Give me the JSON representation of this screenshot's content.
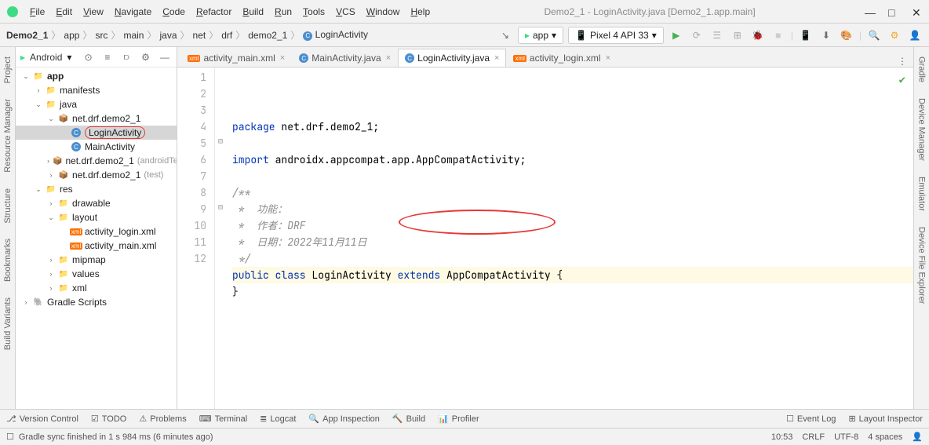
{
  "title": "Demo2_1 - LoginActivity.java [Demo2_1.app.main]",
  "menu": [
    "File",
    "Edit",
    "View",
    "Navigate",
    "Code",
    "Refactor",
    "Build",
    "Run",
    "Tools",
    "VCS",
    "Window",
    "Help"
  ],
  "breadcrumb": [
    "Demo2_1",
    "app",
    "src",
    "main",
    "java",
    "net",
    "drf",
    "demo2_1",
    "LoginActivity"
  ],
  "runConfig": {
    "module": "app",
    "device": "Pixel 4 API 33"
  },
  "leftGutter": [
    "Project",
    "Resource Manager",
    "Structure",
    "Bookmarks",
    "Build Variants"
  ],
  "rightGutter": [
    "Gradle",
    "Device Manager",
    "Emulator",
    "Device File Explorer"
  ],
  "sidebar": {
    "title": "Android",
    "items": [
      {
        "d": 0,
        "a": "v",
        "i": "mod",
        "l": "app",
        "bold": true
      },
      {
        "d": 1,
        "a": ">",
        "i": "fld",
        "l": "manifests"
      },
      {
        "d": 1,
        "a": "v",
        "i": "fld",
        "l": "java"
      },
      {
        "d": 2,
        "a": "v",
        "i": "pkg",
        "l": "net.drf.demo2_1"
      },
      {
        "d": 3,
        "a": "",
        "i": "cls",
        "l": "LoginActivity",
        "sel": true,
        "circle": true
      },
      {
        "d": 3,
        "a": "",
        "i": "cls",
        "l": "MainActivity"
      },
      {
        "d": 2,
        "a": ">",
        "i": "pkg",
        "l": "net.drf.demo2_1",
        "h": "(androidTest)"
      },
      {
        "d": 2,
        "a": ">",
        "i": "pkg",
        "l": "net.drf.demo2_1",
        "h": "(test)"
      },
      {
        "d": 1,
        "a": "v",
        "i": "res",
        "l": "res"
      },
      {
        "d": 2,
        "a": ">",
        "i": "fld",
        "l": "drawable"
      },
      {
        "d": 2,
        "a": "v",
        "i": "fld",
        "l": "layout"
      },
      {
        "d": 3,
        "a": "",
        "i": "xml",
        "l": "activity_login.xml"
      },
      {
        "d": 3,
        "a": "",
        "i": "xml",
        "l": "activity_main.xml"
      },
      {
        "d": 2,
        "a": ">",
        "i": "fld",
        "l": "mipmap"
      },
      {
        "d": 2,
        "a": ">",
        "i": "fld",
        "l": "values"
      },
      {
        "d": 2,
        "a": ">",
        "i": "fld",
        "l": "xml"
      },
      {
        "d": 0,
        "a": ">",
        "i": "grd",
        "l": "Gradle Scripts"
      }
    ]
  },
  "tabs": [
    {
      "icon": "xml",
      "label": "activity_main.xml",
      "close": true
    },
    {
      "icon": "java",
      "label": "MainActivity.java",
      "close": true
    },
    {
      "icon": "java",
      "label": "LoginActivity.java",
      "close": true,
      "active": true
    },
    {
      "icon": "xml",
      "label": "activity_login.xml",
      "close": true
    }
  ],
  "code": {
    "lines": [
      {
        "n": 1,
        "seg": [
          {
            "c": "kw",
            "t": "package "
          },
          {
            "c": "pkg",
            "t": "net.drf.demo2_1;"
          }
        ]
      },
      {
        "n": 2,
        "seg": []
      },
      {
        "n": 3,
        "seg": [
          {
            "c": "kw",
            "t": "import "
          },
          {
            "c": "pkg",
            "t": "androidx.appcompat.app.AppCompatActivity;"
          }
        ]
      },
      {
        "n": 4,
        "seg": []
      },
      {
        "n": 5,
        "fold": "⊟",
        "seg": [
          {
            "c": "cmt",
            "t": "/**"
          }
        ]
      },
      {
        "n": 6,
        "seg": [
          {
            "c": "cmt",
            "t": " *  功能："
          }
        ]
      },
      {
        "n": 7,
        "seg": [
          {
            "c": "cmt",
            "t": " *  作者：DRF"
          }
        ]
      },
      {
        "n": 8,
        "seg": [
          {
            "c": "cmt",
            "t": " *  日期：2022年11月11日"
          }
        ]
      },
      {
        "n": 9,
        "fold": "⊟",
        "seg": [
          {
            "c": "cmt",
            "t": " */"
          }
        ]
      },
      {
        "n": 10,
        "hl": true,
        "seg": [
          {
            "c": "kw",
            "t": "public class "
          },
          {
            "c": "cls",
            "t": "LoginActivity"
          },
          {
            "c": "kw",
            "t": " extends "
          },
          {
            "c": "cls",
            "t": "AppCompatActivity"
          },
          {
            "c": "",
            "t": " {"
          }
        ]
      },
      {
        "n": 11,
        "seg": [
          {
            "c": "",
            "t": "}"
          }
        ]
      },
      {
        "n": 12,
        "seg": []
      }
    ]
  },
  "toolwindows": {
    "left": [
      "Version Control",
      "TODO",
      "Problems",
      "Terminal",
      "Logcat",
      "App Inspection",
      "Build",
      "Profiler"
    ],
    "right": [
      "Event Log",
      "Layout Inspector"
    ]
  },
  "status": {
    "msg": "Gradle sync finished in 1 s 984 ms (6 minutes ago)",
    "pos": "10:53",
    "sep": "CRLF",
    "enc": "UTF-8",
    "indent": "4 spaces"
  }
}
